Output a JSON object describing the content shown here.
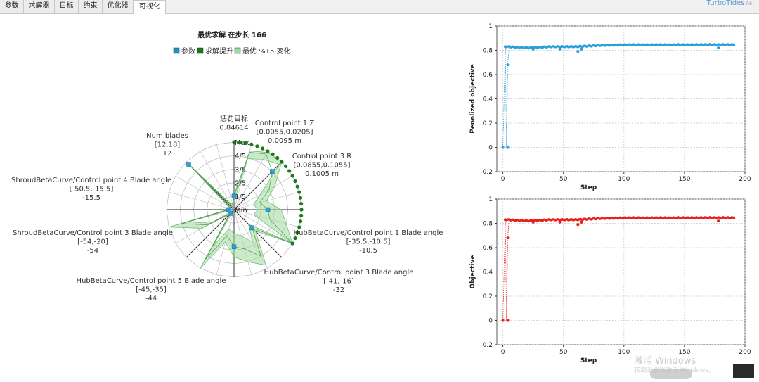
{
  "tabs": [
    {
      "label": "参数",
      "active": false
    },
    {
      "label": "求解器",
      "active": false
    },
    {
      "label": "目标",
      "active": false
    },
    {
      "label": "约束",
      "active": false
    },
    {
      "label": "优化器",
      "active": false
    },
    {
      "label": "可视化",
      "active": true
    }
  ],
  "app": {
    "name": "TurboTides",
    "version": "7.6"
  },
  "radar": {
    "title": "最优求解 在步长 166",
    "legend": [
      {
        "label": "参数",
        "color": "#1f8fc8"
      },
      {
        "label": "求解提升",
        "color": "#1a7a1a"
      },
      {
        "label": "最优 %15 变化",
        "color": "#9ed99e"
      }
    ],
    "ring_labels": [
      "Min",
      "1/5",
      "2/5",
      "3/5",
      "4/5",
      "Max"
    ],
    "axis_labels": [
      {
        "name": "惩罚目标",
        "range": "",
        "value": "0.84614"
      },
      {
        "name": "Control point 1 Z",
        "range": "[0.0055,0.0205]",
        "value": "0.0095 m"
      },
      {
        "name": "Control point 3 R",
        "range": "[0.0855,0.1055]",
        "value": "0.1005 m"
      },
      {
        "name": "HubBetaCurve/Control point 1 Blade angle",
        "range": "[-35.5,-10.5]",
        "value": "-10.5"
      },
      {
        "name": "HubBetaCurve/Control point 3 Blade angle",
        "range": "[-41,-16]",
        "value": "-32"
      },
      {
        "name": "HubBetaCurve/Control point 5 Blade angle",
        "range": "[-45,-35]",
        "value": "-44"
      },
      {
        "name": "ShroudBetaCurve/Control point 3 Blade angle",
        "range": "[-54,-20]",
        "value": "-54"
      },
      {
        "name": "ShroudBetaCurve/Control point 4 Blade angle",
        "range": "[-50.5,-15.5]",
        "value": "-15.5"
      },
      {
        "name": "Num blades",
        "range": "[12,18]",
        "value": "12"
      }
    ]
  },
  "chart_data": [
    {
      "type": "scatter",
      "ylabel": "Penalized objective",
      "xlabel": "Step",
      "xlim": [
        -5,
        200
      ],
      "ylim": [
        -0.2,
        1
      ],
      "xticks": [
        0,
        50,
        100,
        150,
        200
      ],
      "yticks": [
        -0.2,
        0,
        0.2,
        0.4,
        0.6,
        0.8,
        1
      ],
      "grid": true,
      "color": "#2aa0d8",
      "outliers": [
        [
          0,
          0
        ],
        [
          4,
          0
        ],
        [
          4,
          0.68
        ],
        [
          2,
          0.83
        ],
        [
          25,
          0.81
        ],
        [
          28,
          0.82
        ],
        [
          47,
          0.81
        ],
        [
          62,
          0.79
        ],
        [
          65,
          0.81
        ],
        [
          178,
          0.82
        ]
      ],
      "baseline": [
        [
          3,
          0.83
        ],
        [
          20,
          0.82
        ],
        [
          40,
          0.83
        ],
        [
          60,
          0.83
        ],
        [
          80,
          0.84
        ],
        [
          100,
          0.845
        ],
        [
          120,
          0.845
        ],
        [
          140,
          0.845
        ],
        [
          160,
          0.846
        ],
        [
          190,
          0.846
        ]
      ]
    },
    {
      "type": "scatter",
      "ylabel": "Objective",
      "xlabel": "Step",
      "xlim": [
        -5,
        200
      ],
      "ylim": [
        -0.2,
        1
      ],
      "xticks": [
        0,
        50,
        100,
        150,
        200
      ],
      "yticks": [
        -0.2,
        0,
        0.2,
        0.4,
        0.6,
        0.8,
        1
      ],
      "grid": true,
      "color": "#e8201c",
      "outliers": [
        [
          0,
          0
        ],
        [
          4,
          0
        ],
        [
          4,
          0.68
        ],
        [
          2,
          0.83
        ],
        [
          25,
          0.81
        ],
        [
          28,
          0.82
        ],
        [
          47,
          0.81
        ],
        [
          62,
          0.79
        ],
        [
          65,
          0.81
        ],
        [
          178,
          0.82
        ]
      ],
      "baseline": [
        [
          3,
          0.83
        ],
        [
          20,
          0.82
        ],
        [
          40,
          0.83
        ],
        [
          60,
          0.83
        ],
        [
          80,
          0.84
        ],
        [
          100,
          0.845
        ],
        [
          120,
          0.845
        ],
        [
          140,
          0.845
        ],
        [
          160,
          0.846
        ],
        [
          190,
          0.846
        ]
      ]
    }
  ],
  "watermark": {
    "line1": "激活 Windows",
    "line2": "转到设置以激活 Windows。"
  }
}
